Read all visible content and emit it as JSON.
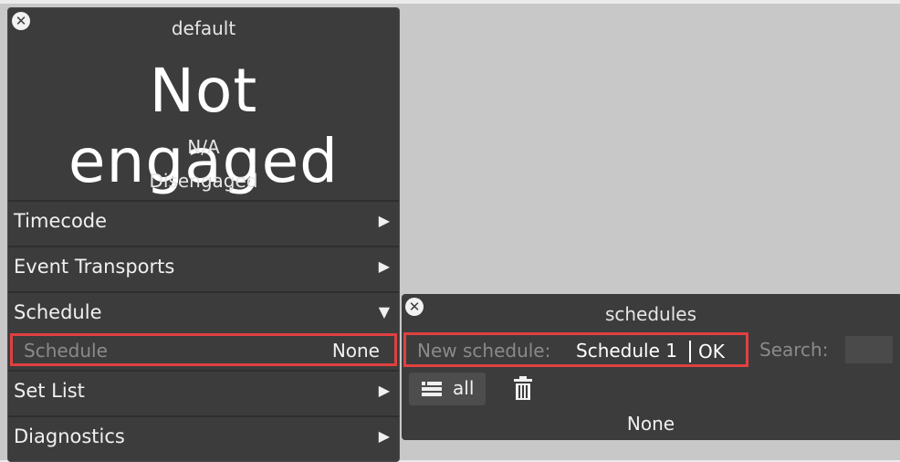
{
  "default_panel": {
    "title": "default",
    "status": "Not engaged",
    "status_sub": "N/A",
    "state": "Disengaged",
    "rows": [
      {
        "label": "Timecode",
        "arrow": "▶"
      },
      {
        "label": "Event Transports",
        "arrow": "▶"
      },
      {
        "label": "Schedule",
        "arrow": "▼"
      },
      {
        "label": "Set List",
        "arrow": "▶"
      },
      {
        "label": "Diagnostics",
        "arrow": "▶"
      }
    ],
    "schedule_field": {
      "label": "Schedule",
      "value": "None"
    }
  },
  "schedules_panel": {
    "title": "schedules",
    "new_schedule_label": "New schedule:",
    "new_schedule_value": "Schedule 1",
    "ok_label": "OK",
    "search_label": "Search:",
    "search_value": "",
    "all_label": "all",
    "empty_text": "None"
  },
  "icons": {
    "close": "close-icon",
    "list": "list-icon",
    "trash": "trash-icon"
  },
  "colors": {
    "panel_bg": "#3c3c3c",
    "highlight": "#e04040",
    "workspace_bg": "#c8c8c8"
  }
}
